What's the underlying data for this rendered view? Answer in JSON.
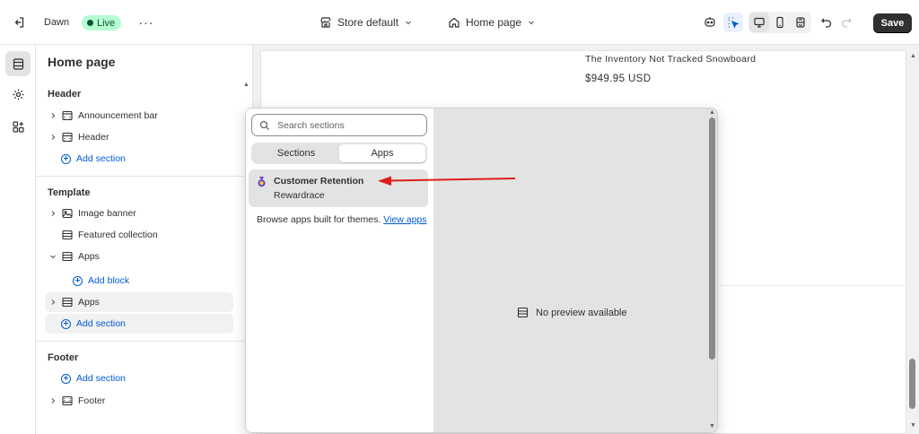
{
  "topbar": {
    "theme_name": "Dawn",
    "live_badge": "Live",
    "more_label": "···",
    "store_selector": "Store default",
    "page_selector": "Home page",
    "save_label": "Save"
  },
  "sidebar": {
    "title": "Home page",
    "groups": {
      "header": {
        "title": "Header",
        "items": [
          "Announcement bar",
          "Header"
        ],
        "add_label": "Add section"
      },
      "template": {
        "title": "Template",
        "items": [
          "Image banner",
          "Featured collection",
          "Apps"
        ],
        "add_block_label": "Add block",
        "apps_item": "Apps",
        "add_label": "Add section"
      },
      "footer": {
        "title": "Footer",
        "add_label": "Add section",
        "items": [
          "Footer"
        ]
      }
    }
  },
  "preview": {
    "product_title": "The Inventory Not Tracked Snowboard",
    "product_price": "$949.95 USD"
  },
  "popover": {
    "search_placeholder": "Search sections",
    "tabs": [
      "Sections",
      "Apps"
    ],
    "active_tab": "Apps",
    "app_item": {
      "name": "Customer Retention",
      "vendor": "Rewardrace"
    },
    "browse_text": "Browse apps built for themes.",
    "browse_link": "View apps",
    "no_preview": "No preview available"
  },
  "colors": {
    "accent_blue": "#005bd3",
    "live_bg": "#b4fed2",
    "live_text": "#0c5132",
    "save_bg": "#303030",
    "annotation_arrow": "#e01b1b"
  }
}
